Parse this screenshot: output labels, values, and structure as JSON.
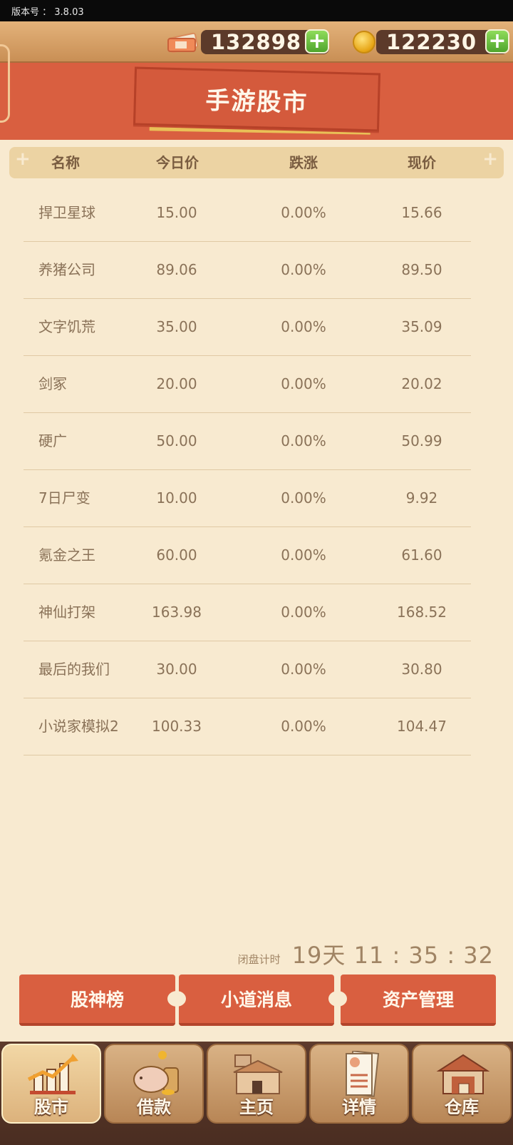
{
  "version": {
    "label": "版本号 ： 3.8.03"
  },
  "currency": {
    "cash": "132898",
    "coins": "122230"
  },
  "title": "手游股市",
  "table": {
    "columns": [
      "名称",
      "今日价",
      "跌涨",
      "现价"
    ],
    "rows": [
      {
        "name": "捍卫星球",
        "today": "15.00",
        "change": "0.00%",
        "price": "15.66"
      },
      {
        "name": "养猪公司",
        "today": "89.06",
        "change": "0.00%",
        "price": "89.50"
      },
      {
        "name": "文字饥荒",
        "today": "35.00",
        "change": "0.00%",
        "price": "35.09"
      },
      {
        "name": "剑冢",
        "today": "20.00",
        "change": "0.00%",
        "price": "20.02"
      },
      {
        "name": "硬广",
        "today": "50.00",
        "change": "0.00%",
        "price": "50.99"
      },
      {
        "name": "7日尸变",
        "today": "10.00",
        "change": "0.00%",
        "price": "9.92"
      },
      {
        "name": "氪金之王",
        "today": "60.00",
        "change": "0.00%",
        "price": "61.60"
      },
      {
        "name": "神仙打架",
        "today": "163.98",
        "change": "0.00%",
        "price": "168.52"
      },
      {
        "name": "最后的我们",
        "today": "30.00",
        "change": "0.00%",
        "price": "30.80"
      },
      {
        "name": "小说家模拟2",
        "today": "100.33",
        "change": "0.00%",
        "price": "104.47"
      }
    ]
  },
  "countdown": {
    "label": "闭盘计时",
    "value": "19天 11 : 35 : 32"
  },
  "actions": {
    "leaderboard": "股神榜",
    "news": "小道消息",
    "assets": "资产管理"
  },
  "nav": [
    {
      "label": "股市",
      "icon": "stock-chart-icon"
    },
    {
      "label": "借款",
      "icon": "piggy-bank-icon"
    },
    {
      "label": "主页",
      "icon": "house-icon"
    },
    {
      "label": "详情",
      "icon": "profile-document-icon"
    },
    {
      "label": "仓库",
      "icon": "warehouse-icon"
    }
  ],
  "colors": {
    "accent": "#d95f40",
    "background": "#f8ead0",
    "header": "#ecd3a3",
    "text": "#8a7258"
  }
}
